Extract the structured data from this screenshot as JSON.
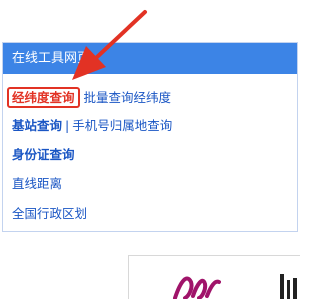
{
  "panel": {
    "title": "在线工具网页",
    "rows": {
      "row1": {
        "highlighted": "经纬度查询",
        "link": "批量查询经纬度"
      },
      "row2": {
        "link1": "基站查询",
        "sep": "|",
        "link2": "手机号归属地查询"
      },
      "row3": {
        "link": "身份证查询"
      },
      "row4": {
        "link": "直线距离"
      },
      "row5": {
        "link": "全国行政区划"
      }
    }
  },
  "colors": {
    "header_bg": "#3c84e6",
    "link": "#1a56c4",
    "highlight_border": "#e23224",
    "arrow": "#e23224"
  },
  "icons": {
    "annotation": "red-arrow-icon",
    "ad_logo": "magenta-script-logo"
  }
}
